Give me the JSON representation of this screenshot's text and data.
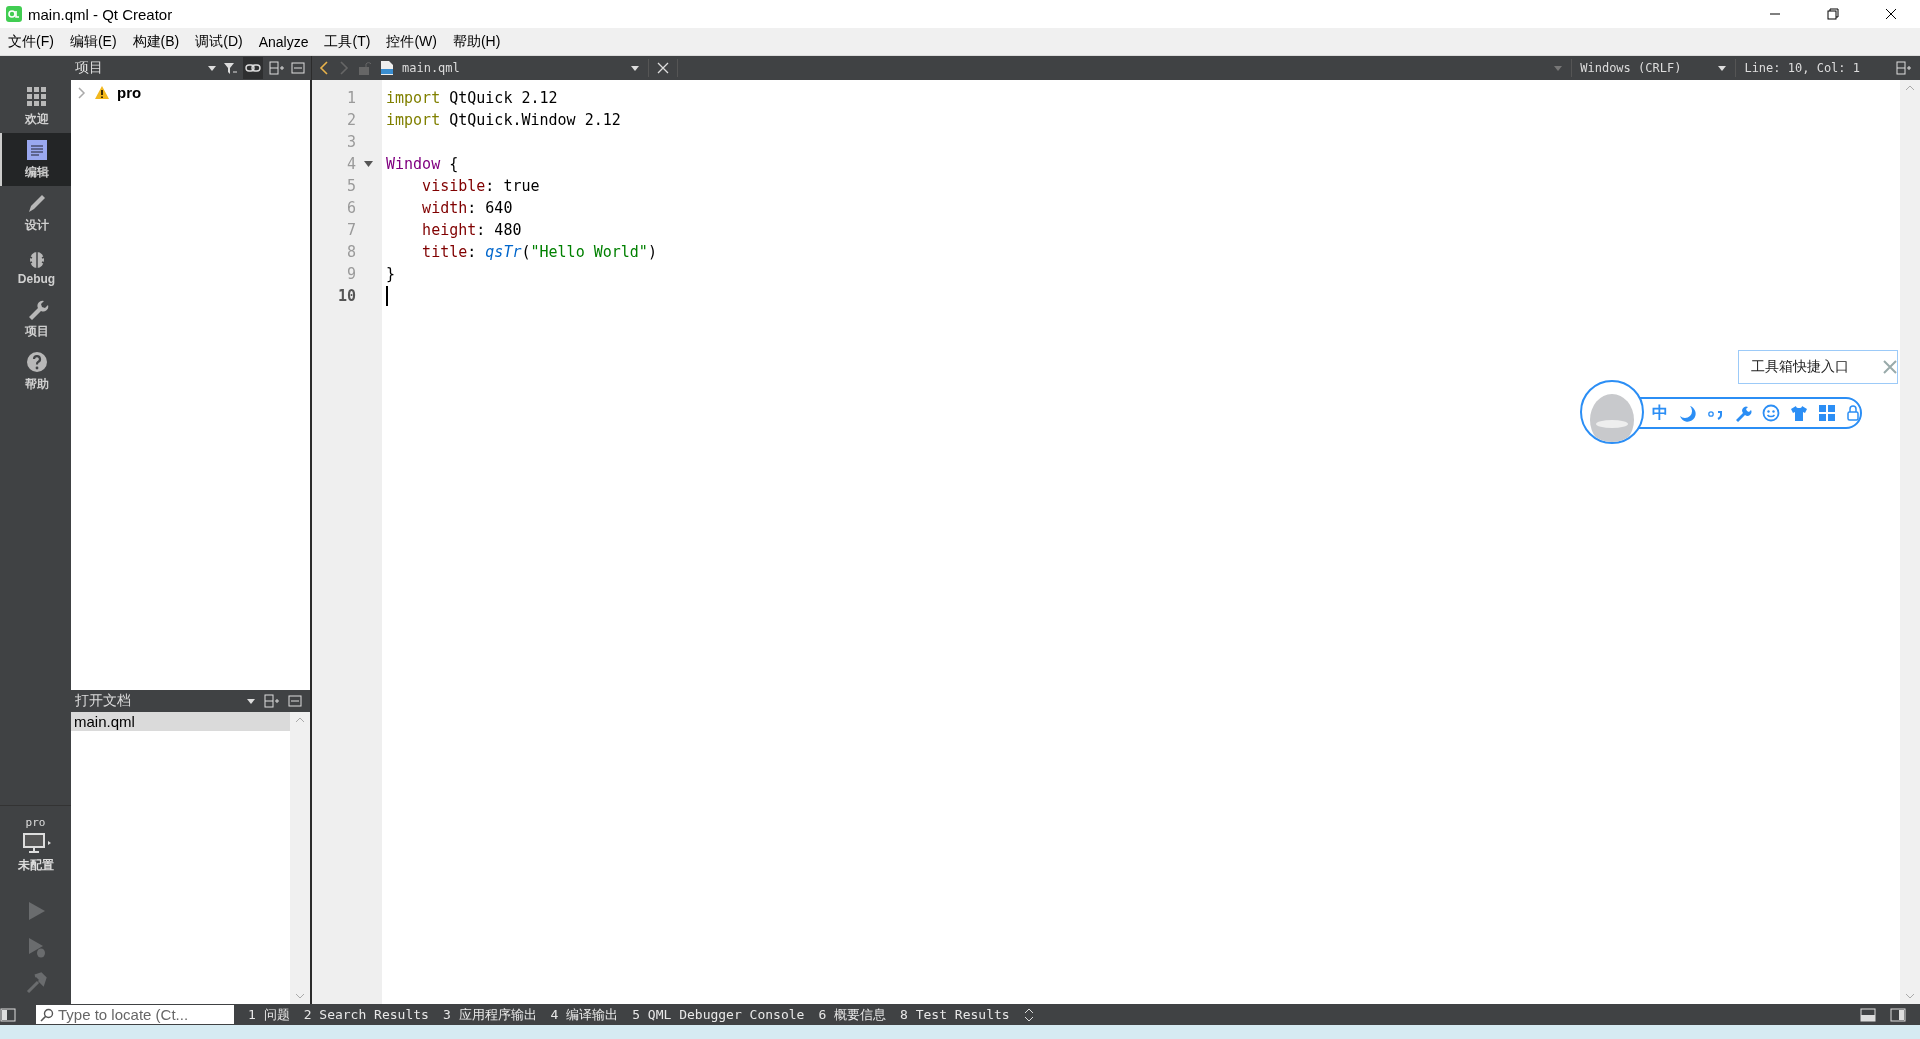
{
  "window": {
    "title": "main.qml - Qt Creator"
  },
  "menu": [
    "文件(F)",
    "编辑(E)",
    "构建(B)",
    "调试(D)",
    "Analyze",
    "工具(T)",
    "控件(W)",
    "帮助(H)"
  ],
  "mode_bar": [
    {
      "kind": "welcome",
      "label": "欢迎",
      "selected": false
    },
    {
      "kind": "edit",
      "label": "编辑",
      "selected": true
    },
    {
      "kind": "design",
      "label": "设计",
      "selected": false
    },
    {
      "kind": "debug",
      "label": "Debug",
      "selected": false
    },
    {
      "kind": "projects",
      "label": "项目",
      "selected": false
    },
    {
      "kind": "help",
      "label": "帮助",
      "selected": false
    }
  ],
  "kit": {
    "project": "pro",
    "status": "未配置"
  },
  "project_panel": {
    "title": "项目",
    "tree": [
      {
        "label": "pro",
        "warning": true,
        "expanded": false
      }
    ]
  },
  "open_documents": {
    "title": "打开文档",
    "items": [
      {
        "label": "main.qml",
        "selected": true
      }
    ]
  },
  "editor": {
    "tab": "main.qml",
    "line_ending": "Windows (CRLF)",
    "position": "Line: 10, Col: 1",
    "lines": [
      {
        "number": "1",
        "current": false,
        "foldable": false,
        "tokens": [
          {
            "kind": "keyword",
            "text": "import"
          },
          {
            "kind": "plain",
            "text": " QtQuick 2.12"
          }
        ]
      },
      {
        "number": "2",
        "current": false,
        "foldable": false,
        "tokens": [
          {
            "kind": "keyword",
            "text": "import"
          },
          {
            "kind": "plain",
            "text": " QtQuick.Window 2.12"
          }
        ]
      },
      {
        "number": "3",
        "current": false,
        "foldable": false
      },
      {
        "number": "4",
        "current": false,
        "foldable": true,
        "tokens": [
          {
            "kind": "type",
            "text": "Window"
          },
          {
            "kind": "plain",
            "text": " {"
          }
        ]
      },
      {
        "number": "5",
        "current": false,
        "foldable": false,
        "tokens": [
          {
            "kind": "property",
            "text": "    visible"
          },
          {
            "kind": "plain",
            "text": ": true"
          }
        ]
      },
      {
        "number": "6",
        "current": false,
        "foldable": false,
        "tokens": [
          {
            "kind": "property",
            "text": "    width"
          },
          {
            "kind": "plain",
            "text": ": 640"
          }
        ]
      },
      {
        "number": "7",
        "current": false,
        "foldable": false,
        "tokens": [
          {
            "kind": "property",
            "text": "    height"
          },
          {
            "kind": "plain",
            "text": ": 480"
          }
        ]
      },
      {
        "number": "8",
        "current": false,
        "foldable": false,
        "tokens": [
          {
            "kind": "property",
            "text": "    title"
          },
          {
            "kind": "plain",
            "text": ": "
          },
          {
            "kind": "function",
            "text": "qsTr"
          },
          {
            "kind": "plain",
            "text": "("
          },
          {
            "kind": "string",
            "text": "\"Hello World\""
          },
          {
            "kind": "plain",
            "text": ")"
          }
        ]
      },
      {
        "number": "9",
        "current": false,
        "foldable": false,
        "tokens": [
          {
            "kind": "plain",
            "text": "}"
          }
        ]
      },
      {
        "number": "10",
        "current": true,
        "foldable": false
      }
    ]
  },
  "toolbox": {
    "tooltip": "工具箱快捷入口",
    "items": [
      {
        "kind": "text",
        "text": "中"
      },
      {
        "kind": "moon"
      },
      {
        "kind": "punctuation"
      },
      {
        "kind": "wrench"
      },
      {
        "kind": "smiley"
      },
      {
        "kind": "shirt"
      },
      {
        "kind": "grid"
      },
      {
        "kind": "lock"
      }
    ]
  },
  "locator": {
    "placeholder": "Type to locate (Ct..."
  },
  "output_tabs": [
    "1 问题",
    "2 Search Results",
    "3 应用程序输出",
    "4 编译输出",
    "5 QML Debugger Console",
    "6 概要信息",
    "8 Test Results"
  ]
}
